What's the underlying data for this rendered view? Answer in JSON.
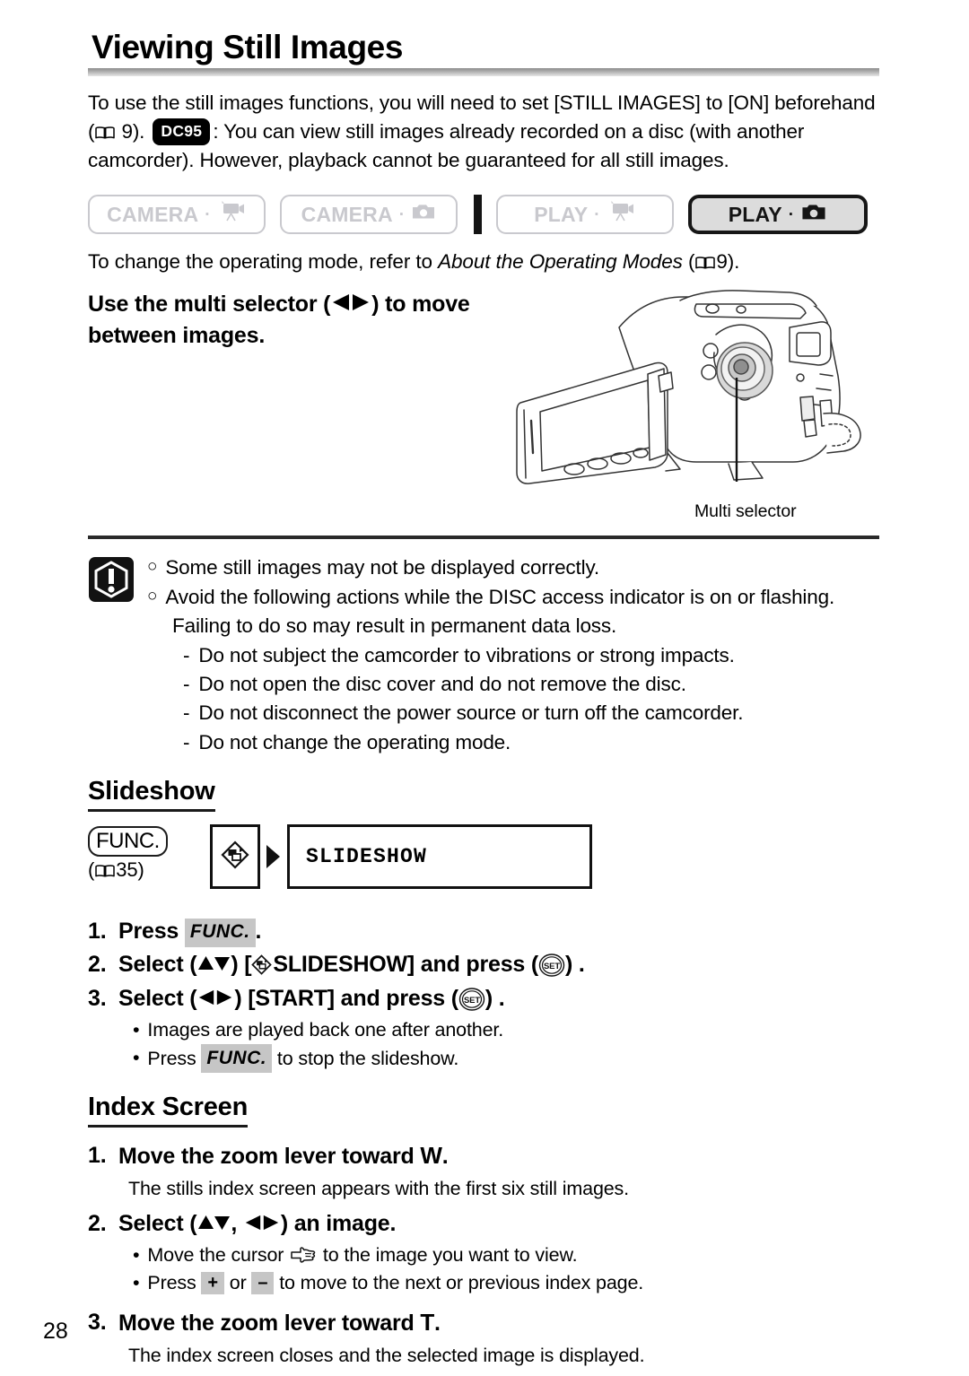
{
  "page": {
    "number": "28",
    "title": "Viewing Still Images"
  },
  "intro": {
    "part1": "To use the still images functions, you will need to set [STILL IMAGES] to [ON] beforehand",
    "part2_open": "(",
    "part2_page": "9).",
    "badge": "DC95",
    "part3": ": You can view still images already recorded on a disc (with another",
    "part4": "camcorder). However, playback cannot be guaranteed for all still images."
  },
  "modes": {
    "buttons": [
      {
        "label": "CAMERA",
        "separator": "·",
        "icon": "video-camera-icon",
        "active": false
      },
      {
        "label": "CAMERA",
        "separator": "·",
        "icon": "photo-camera-icon",
        "active": false
      },
      {
        "label": "PLAY",
        "separator": "·",
        "icon": "video-camera-icon",
        "active": false
      },
      {
        "label": "PLAY",
        "separator": "·",
        "icon": "photo-camera-icon",
        "active": true
      }
    ],
    "note_before": "To change the operating mode, refer to ",
    "note_italic": "About the Operating Modes",
    "note_after_open": " (",
    "note_page": "9)."
  },
  "selector": {
    "line1_a": "Use the multi selector (",
    "line1_b": ") to move",
    "line2": "between images.",
    "figure_caption": "Multi selector"
  },
  "caution": {
    "icon": "warning-exclamation-icon",
    "items": [
      {
        "bullet": "○",
        "text": "Some still images may not be displayed correctly."
      },
      {
        "bullet": "○",
        "text": "Avoid the following actions while the DISC access indicator is on or flashing."
      }
    ],
    "continuation": "Failing to do so may result in permanent data loss.",
    "dashes": [
      "Do not subject the camcorder to vibrations or strong impacts.",
      "Do not open the disc cover and do not remove the disc.",
      "Do not disconnect the power source or turn off the camcorder.",
      "Do not change the operating mode."
    ]
  },
  "slideshow": {
    "heading": "Slideshow",
    "func_label": "FUNC.",
    "func_page_open": "(",
    "func_page": "35)",
    "flow_icon": "slideshow-icon",
    "flow_label": "SLIDESHOW",
    "steps": [
      {
        "num": "1.",
        "pre": "Press ",
        "chip": "FUNC.",
        "post": "."
      },
      {
        "num": "2.",
        "pre": "Select (",
        "post": ") [",
        "menu": "SLIDESHOW] and press (",
        "tail": ") ."
      },
      {
        "num": "3.",
        "pre": "Select (",
        "post": ") [START] and press (",
        "tail": ") ."
      }
    ],
    "notes": [
      {
        "bullet": "•",
        "text": "Images are played back one after another."
      },
      {
        "bullet": "•",
        "pre": "Press ",
        "chip": "FUNC.",
        "post": " to stop the slideshow."
      }
    ]
  },
  "index_screen": {
    "heading": "Index Screen",
    "step1": {
      "num": "1.",
      "text_a": "Move the zoom lever toward ",
      "key": "W",
      "text_b": "."
    },
    "step1_desc": "The stills index screen appears with the first six still images.",
    "step2": {
      "num": "2.",
      "pre": "Select (",
      "mid": ", ",
      "post": ") an image."
    },
    "step2_notes": [
      {
        "bullet": "•",
        "pre": "Move the cursor ",
        "post": " to the image you want to view."
      },
      {
        "bullet": "•",
        "pre": "Press ",
        "plus": "+",
        "mid": " or ",
        "minus": "–",
        "post": " to move to the next or previous index page."
      }
    ],
    "step3": {
      "num": "3.",
      "text_a": "Move the zoom lever toward ",
      "key": "T",
      "text_b": "."
    },
    "step3_desc": "The index screen closes and the selected image is displayed."
  },
  "colors": {
    "active_button_fill": "#dcdcdc",
    "inactive_outline": "#c9c9ce",
    "chip_gray": "#c6c6c6",
    "rule_dark": "#2a2a2a",
    "text": "#000000"
  }
}
